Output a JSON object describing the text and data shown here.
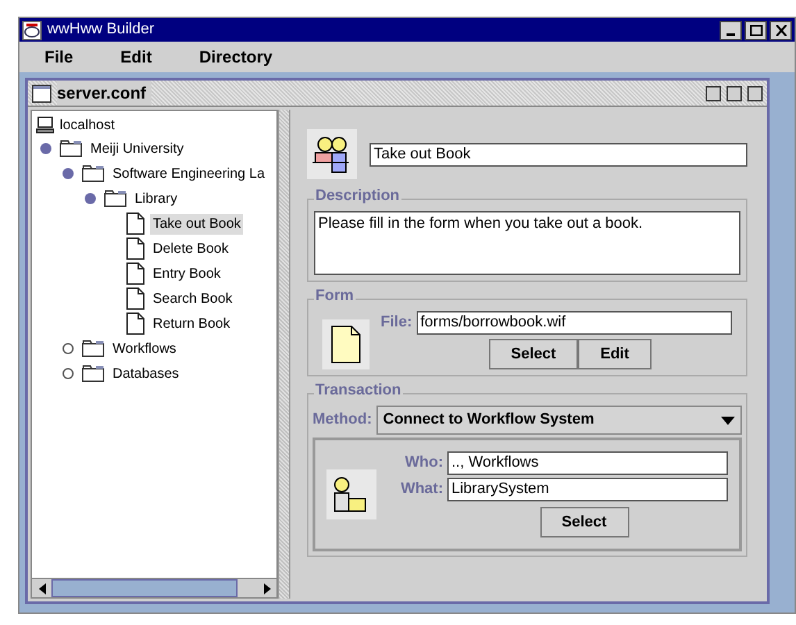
{
  "window": {
    "title": "wwHww Builder"
  },
  "menu": [
    "File",
    "Edit",
    "Directory"
  ],
  "frame": {
    "title": "server.conf"
  },
  "tree": {
    "root": "localhost",
    "children": [
      {
        "label": "Meiji University",
        "kind": "folder",
        "expanded": true,
        "children": [
          {
            "label": "Software Engineering La",
            "kind": "folder",
            "expanded": true,
            "children": [
              {
                "label": "Library",
                "kind": "folder",
                "expanded": true,
                "children": [
                  {
                    "label": "Take out Book",
                    "kind": "document",
                    "selected": true
                  },
                  {
                    "label": "Delete Book",
                    "kind": "document",
                    "selected": false
                  },
                  {
                    "label": "Entry Book",
                    "kind": "document",
                    "selected": false
                  },
                  {
                    "label": "Search Book",
                    "kind": "document",
                    "selected": false
                  },
                  {
                    "label": "Return Book",
                    "kind": "document",
                    "selected": false
                  }
                ]
              }
            ]
          },
          {
            "label": "Workflows",
            "kind": "folder",
            "expanded": false
          },
          {
            "label": "Databases",
            "kind": "folder",
            "expanded": false
          }
        ]
      }
    ]
  },
  "detail": {
    "name": "Take out Book",
    "description": {
      "title": "Description",
      "text": "Please fill in the form when you take out a book."
    },
    "form": {
      "title": "Form",
      "file_label": "File:",
      "file": "forms/borrowbook.wif",
      "buttons": [
        "Select",
        "Edit"
      ]
    },
    "transaction": {
      "title": "Transaction",
      "method_label": "Method:",
      "method": "Connect to Workflow System",
      "who_label": "Who:",
      "who": ".., Workflows",
      "what_label": "What:",
      "what": "LibrarySystem",
      "button": "Select"
    }
  }
}
